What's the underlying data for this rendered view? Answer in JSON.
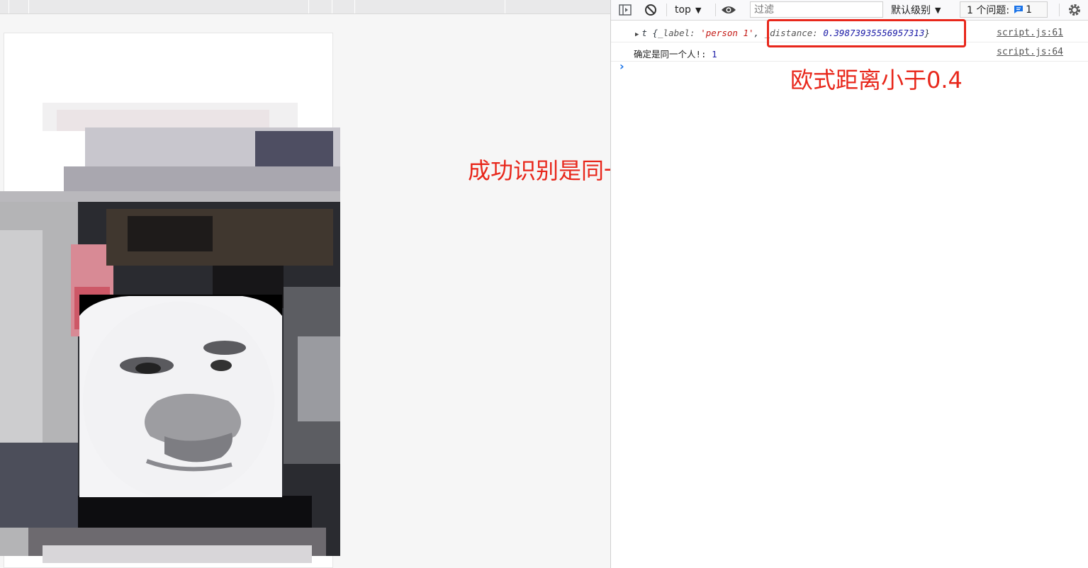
{
  "annotations": {
    "distance_note": "欧式距离小于0.4",
    "result_note": "成功识别是同一个人"
  },
  "devtools": {
    "toolbar": {
      "context": "top",
      "filter_placeholder": "过滤",
      "levels": "默认级别",
      "issues_label": "1 个问题:",
      "issues_count": "1"
    },
    "console": {
      "rows": [
        {
          "prefix": "t",
          "open": "{",
          "label_key": "_label:",
          "label_val": "'person 1'",
          "comma": ",",
          "distance_key": "_distance:",
          "distance_val": "0.39873935556957313",
          "close": "}",
          "source": "script.js:61"
        },
        {
          "message": "确定是同一个人!:",
          "value": "1",
          "source": "script.js:64"
        }
      ],
      "prompt": "›"
    }
  },
  "colors": {
    "annotation": "#e8271b",
    "accent": "#1a73e8"
  },
  "icons": [
    "dock-panel-icon",
    "clear-console-icon",
    "chevron-down-icon",
    "eye-icon",
    "message-icon",
    "gear-icon"
  ]
}
